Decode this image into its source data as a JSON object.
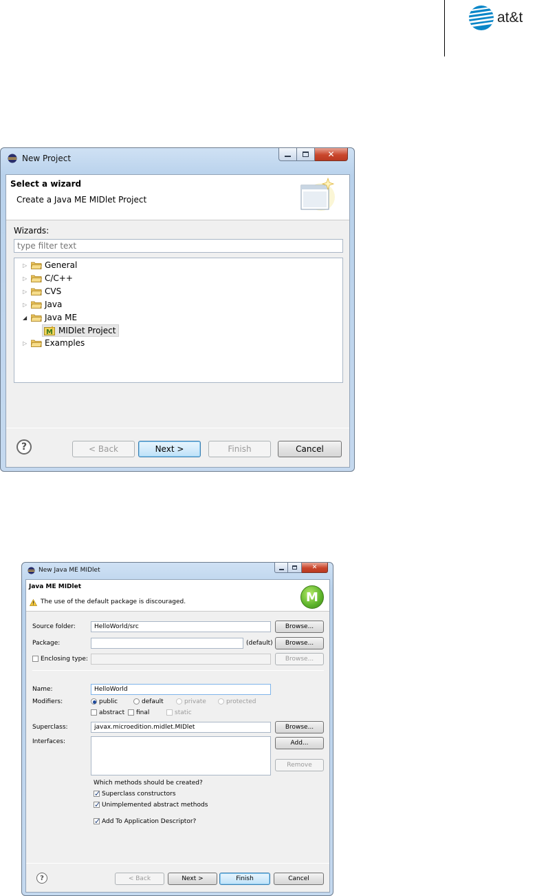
{
  "logo": {
    "text": "at&t",
    "icon": "globe-icon",
    "brand_color": "#0a86c8"
  },
  "window1": {
    "title": "New Project",
    "header_title": "Select a wizard",
    "header_subtitle": "Create a Java ME MIDlet Project",
    "wizards_label": "Wizards:",
    "filter_placeholder": "type filter text",
    "tree": [
      {
        "label": "General",
        "expander": "▷"
      },
      {
        "label": "C/C++",
        "expander": "▷"
      },
      {
        "label": "CVS",
        "expander": "▷"
      },
      {
        "label": "Java",
        "expander": "▷"
      },
      {
        "label": "Java ME",
        "expander": "◢"
      },
      {
        "label": "MIDlet Project",
        "expander": ""
      },
      {
        "label": "Examples",
        "expander": "▷"
      }
    ],
    "buttons": {
      "back": "< Back",
      "next": "Next >",
      "finish": "Finish",
      "cancel": "Cancel"
    },
    "help": "?"
  },
  "window2": {
    "title": "New Java ME MIDlet",
    "header_title": "Java ME MIDlet",
    "warning": "The use of the default package is discouraged.",
    "source_folder_label": "Source folder:",
    "source_folder_value": "HelloWorld/src",
    "package_label": "Package:",
    "package_value": "",
    "default_label": "(default)",
    "enclosing_type_label": "Enclosing type:",
    "name_label": "Name:",
    "name_value": "HelloWorld",
    "modifiers_label": "Modifiers:",
    "modifiers": [
      "public",
      "default",
      "private",
      "protected"
    ],
    "modifiers2": [
      "abstract",
      "final",
      "static"
    ],
    "superclass_label": "Superclass:",
    "superclass_value": "javax.microedition.midlet.MIDlet",
    "interfaces_label": "Interfaces:",
    "browse": "Browse...",
    "add": "Add...",
    "remove": "Remove",
    "methods_question": "Which methods should be created?",
    "method_options": [
      "Superclass constructors",
      "Unimplemented abstract methods"
    ],
    "add_descriptor": "Add To Application Descriptor?",
    "buttons": {
      "back": "< Back",
      "next": "Next >",
      "finish": "Finish",
      "cancel": "Cancel"
    },
    "help": "?",
    "icon_letter": "M"
  }
}
